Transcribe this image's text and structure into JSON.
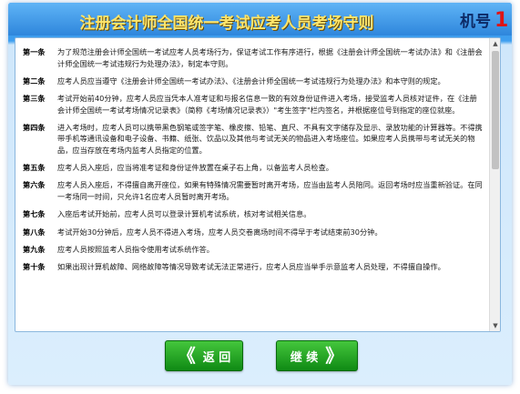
{
  "header": {
    "title": "注册会计师全国统一考试应考人员考场守则",
    "machine_label": "机号",
    "machine_number": "1"
  },
  "rules": [
    {
      "num": "第一条",
      "text": "为了规范注册会计师全国统一考试应考人员考场行为，保证考试工作有序进行，根据《注册会计师全国统一考试办法》和《注册会计师全国统一考试违规行为处理办法》，制定本守则。"
    },
    {
      "num": "第二条",
      "text": "应考人员应当遵守《注册会计师全国统一考试办法》、《注册会计师全国统一考试违规行为处理办法》和本守则的规定。"
    },
    {
      "num": "第三条",
      "text": "考试开始前40分钟，应考人员应当凭本人准考证和与报名信息一致的有效身份证件进入考场，接受监考人员核对证件，在《注册会计师全国统一考试考场情况记录表》（简称《考场情况记录表》）\"考生签字\"栏内签名，并根据座位号到指定的座位就座。"
    },
    {
      "num": "第四条",
      "text": "进入考场时，应考人员可以携带黑色钢笔或签字笔、橡皮擦、铅笔、直尺、不具有文字储存及显示、录放功能的计算器等。不得携带手机等通讯设备和电子设备、书籍、纸张、饮品以及其他与考试无关的物品进入考场座位。如果应考人员携带与考试无关的物品，应当存放在考场内监考人员指定的位置。"
    },
    {
      "num": "第五条",
      "text": "应考人员入座后，应当将准考证和身份证件放置在桌子右上角，以备监考人员检查。"
    },
    {
      "num": "第六条",
      "text": "应考人员入座后，不得擅自离开座位，如果有特殊情况需要暂时离开考场，应当由监考人员陪同。返回考场时应当重新验证。在同一考场同一时间，只允许1名应考人员暂时离开考场。"
    },
    {
      "num": "第七条",
      "text": "入座后考试开始前，应考人员可以登录计算机考试系统，核对考试相关信息。"
    },
    {
      "num": "第八条",
      "text": "考试开始30分钟后，应考人员不得进入考场，应考人员交卷离场时间不得早于考试结束前30分钟。"
    },
    {
      "num": "第九条",
      "text": "应考人员按照监考人员指令使用考试系统作答。"
    },
    {
      "num": "第十条",
      "text": "如果出现计算机故障、网络故障等情况导致考试无法正常进行，应考人员应当举手示意监考人员处理，不得擅自操作。"
    }
  ],
  "buttons": {
    "back_chevron": "《",
    "back_label": "返 回",
    "next_label": "继 续",
    "next_chevron": "》"
  },
  "colors": {
    "header_bg": "#2e86dc",
    "title_text": "#ffe66b",
    "machine_number": "#e01414",
    "button_green": "#1aa01f"
  }
}
